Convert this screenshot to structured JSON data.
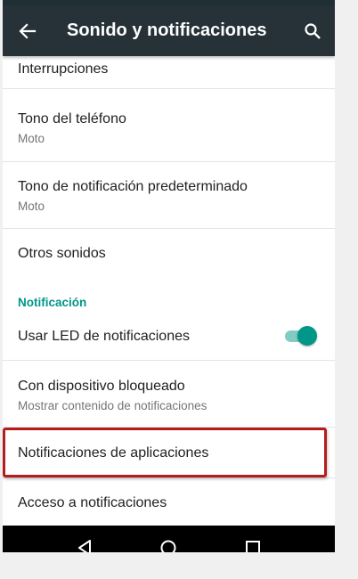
{
  "appbar": {
    "title": "Sonido y notificaciones",
    "back_icon": "arrow-back-icon",
    "search_icon": "search-icon",
    "color": "#263238"
  },
  "settings": {
    "interrupciones": {
      "title": "Interrupciones"
    },
    "tono_telefono": {
      "title": "Tono del teléfono",
      "summary": "Moto"
    },
    "tono_notificacion": {
      "title": "Tono de notificación predeterminado",
      "summary": "Moto"
    },
    "otros_sonidos": {
      "title": "Otros sonidos"
    },
    "notificacion_section": {
      "title": "Notificación"
    },
    "usar_led": {
      "title": "Usar LED de notificaciones",
      "enabled": true
    },
    "bloqueado": {
      "title": "Con dispositivo bloqueado",
      "summary": "Mostrar contenido de notificaciones"
    },
    "notif_apps": {
      "title": "Notificaciones de aplicaciones",
      "highlighted": true
    },
    "acceso": {
      "title": "Acceso a notificaciones"
    }
  },
  "colors": {
    "accent": "#009688",
    "highlight_border": "#b71c1c"
  },
  "navbar": {
    "back_icon": "nav-back-triangle-icon",
    "home_icon": "nav-home-circle-icon",
    "recents_icon": "nav-recents-square-icon"
  }
}
